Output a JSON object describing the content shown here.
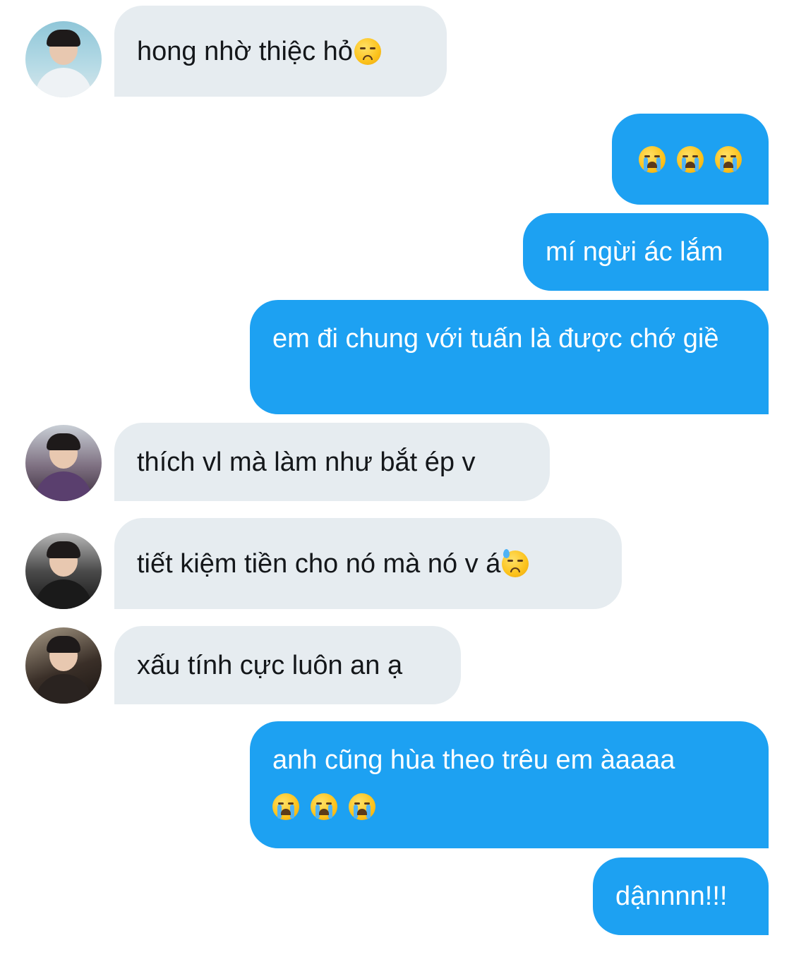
{
  "messages": [
    {
      "side": "in",
      "text": "hong nhờ thiệc hỏ",
      "emoji": [
        "disappointed-face"
      ]
    },
    {
      "side": "out",
      "text": "",
      "emoji": [
        "loudly-crying-face",
        "loudly-crying-face",
        "loudly-crying-face"
      ]
    },
    {
      "side": "out",
      "text": "mí ngừi ác lắm"
    },
    {
      "side": "out",
      "text": "em đi chung với tuấn là được chớ giề"
    },
    {
      "side": "in",
      "text": "thích vl mà làm như bắt ép v"
    },
    {
      "side": "in",
      "text": "tiết kiệm tiền cho nó mà nó v á",
      "emoji": [
        "downcast-face-with-sweat"
      ]
    },
    {
      "side": "in",
      "text": "xấu tính cực luôn an ạ"
    },
    {
      "side": "out",
      "text": "anh cũng hùa theo trêu em àaaaa",
      "emoji": [
        "loudly-crying-face",
        "loudly-crying-face",
        "loudly-crying-face"
      ]
    },
    {
      "side": "out",
      "text": "dậnnnn!!!"
    }
  ],
  "colors": {
    "incoming_bubble": "#e6ecf0",
    "outgoing_bubble": "#1da1f2",
    "incoming_text": "#14171a",
    "outgoing_text": "#ffffff"
  }
}
